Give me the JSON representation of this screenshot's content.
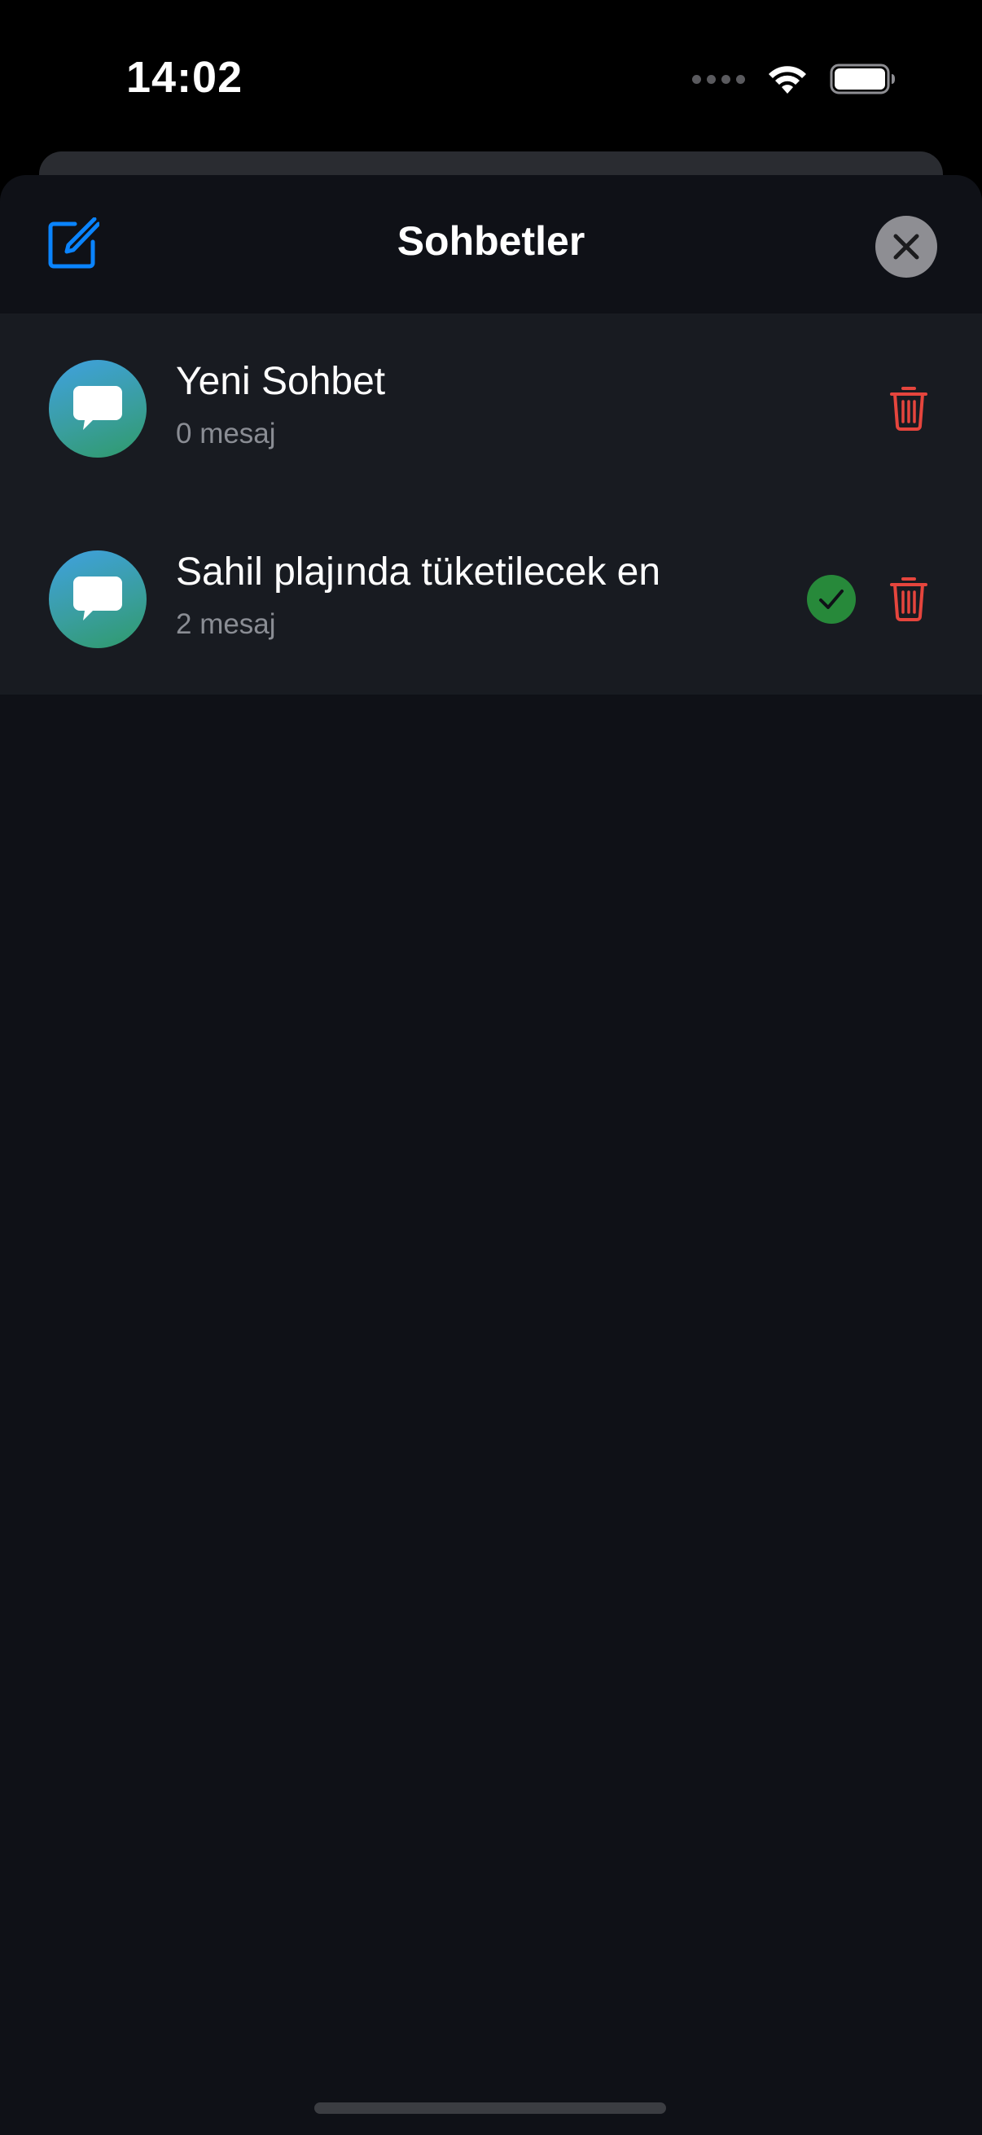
{
  "status_bar": {
    "time": "14:02"
  },
  "header": {
    "title": "Sohbetler",
    "compose_icon": "compose-icon",
    "close_icon": "close-icon"
  },
  "chats": [
    {
      "title": "Yeni Sohbet",
      "subtitle": "0 mesaj",
      "selected": false
    },
    {
      "title": "Sahil plajında tüketilecek en",
      "subtitle": "2 mesaj",
      "selected": true
    }
  ],
  "colors": {
    "accent": "#0a84ff",
    "delete": "#e5453d",
    "selected_badge": "#27893a",
    "background": "#0f1117",
    "row_background": "#181b21"
  }
}
